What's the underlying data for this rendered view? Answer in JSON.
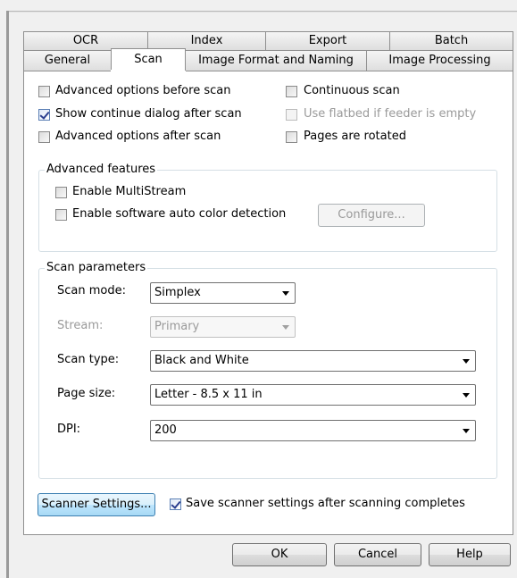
{
  "tabs_row1": [
    "OCR",
    "Index",
    "Export",
    "Batch"
  ],
  "tabs_row2": [
    "General",
    "Scan",
    "Image Format and Naming",
    "Image Processing"
  ],
  "active_tab": "Scan",
  "options": {
    "advanced_before": {
      "label": "Advanced options before scan",
      "checked": false
    },
    "show_continue": {
      "label": "Show continue dialog after scan",
      "checked": true
    },
    "advanced_after": {
      "label": "Advanced options after scan",
      "checked": false
    },
    "continuous": {
      "label": "Continuous scan",
      "checked": false
    },
    "use_flatbed": {
      "label": "Use flatbed if feeder is empty",
      "checked": false,
      "disabled": true
    },
    "pages_rotated": {
      "label": "Pages are rotated",
      "checked": false
    }
  },
  "advanced_features": {
    "title": "Advanced features",
    "multistream": {
      "label": "Enable MultiStream",
      "checked": false
    },
    "auto_color": {
      "label": "Enable software auto color detection",
      "checked": false
    },
    "configure_label": "Configure..."
  },
  "scan_parameters": {
    "title": "Scan parameters",
    "scan_mode": {
      "label": "Scan mode:",
      "value": "Simplex"
    },
    "stream": {
      "label": "Stream:",
      "value": "Primary"
    },
    "scan_type": {
      "label": "Scan type:",
      "value": "Black and White"
    },
    "page_size": {
      "label": "Page size:",
      "value": "Letter - 8.5 x 11 in"
    },
    "dpi": {
      "label": "DPI:",
      "value": "200"
    }
  },
  "scanner_settings_label": "Scanner Settings...",
  "save_settings": {
    "label": "Save scanner settings after scanning completes",
    "checked": true
  },
  "footer": {
    "ok": "OK",
    "cancel": "Cancel",
    "help": "Help"
  }
}
